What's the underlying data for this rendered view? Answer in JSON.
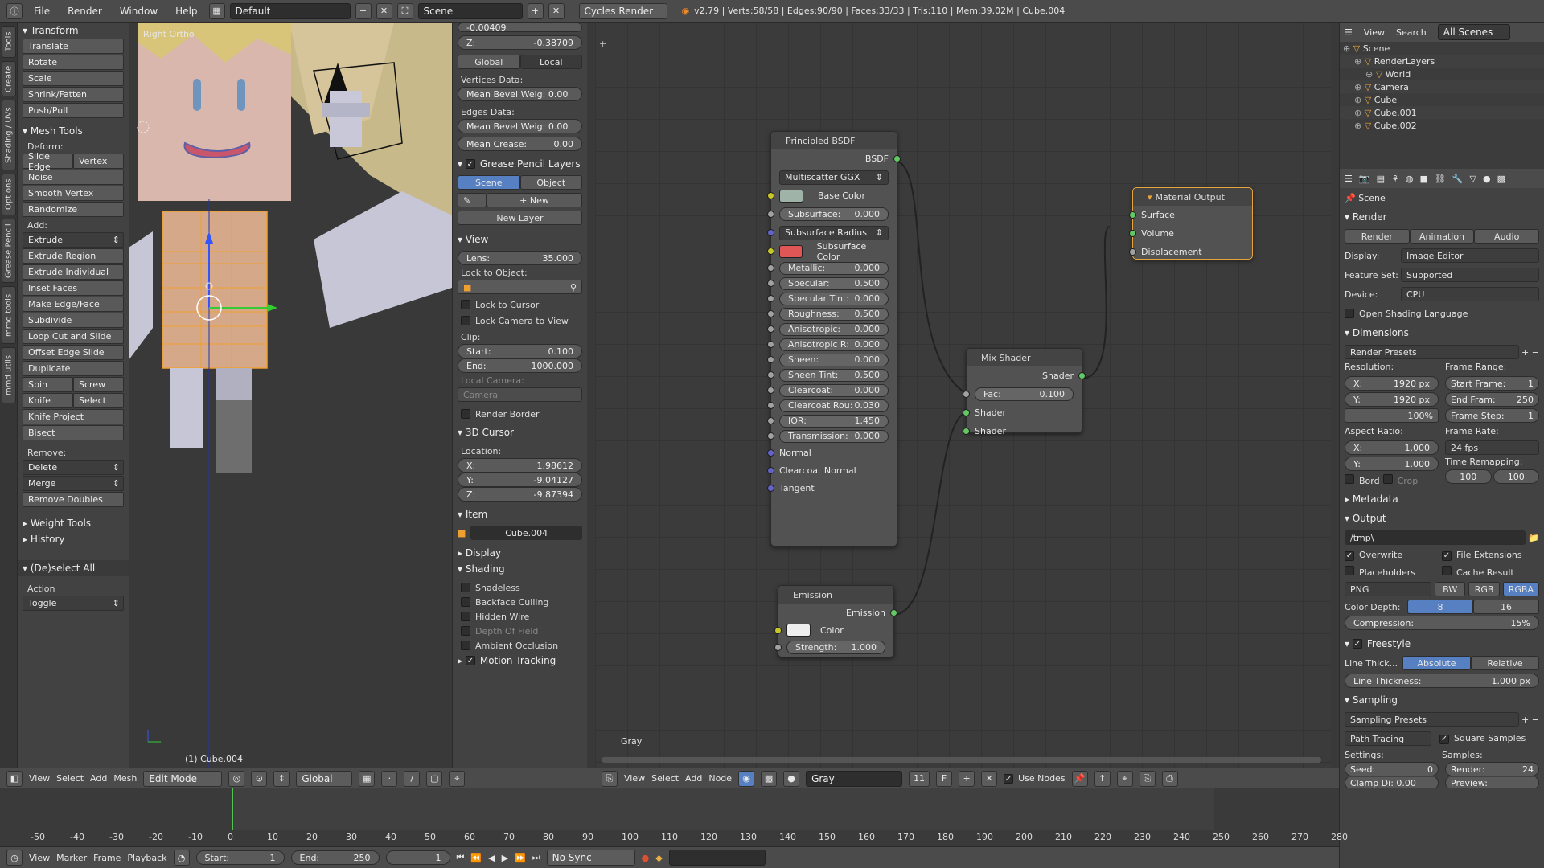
{
  "topbar": {
    "menus": [
      "File",
      "Render",
      "Window",
      "Help"
    ],
    "layout": "Default",
    "scene": "Scene",
    "engine": "Cycles Render",
    "stats": "v2.79 | Verts:58/58 | Edges:90/90 | Faces:33/33 | Tris:110 | Mem:39.02M | Cube.004"
  },
  "lefttabs": [
    "Tools",
    "Create",
    "Shading / UVs",
    "Options",
    "Grease Pencil",
    "mmd tools",
    "mmd utils"
  ],
  "tools": {
    "transform": {
      "title": "Transform",
      "items": [
        "Translate",
        "Rotate",
        "Scale",
        "Shrink/Fatten",
        "Push/Pull"
      ]
    },
    "mesh_tools": {
      "title": "Mesh Tools",
      "deform": "Deform:",
      "slide_edge": "Slide Edge",
      "vertex": "Vertex",
      "noise": "Noise",
      "smooth_vertex": "Smooth Vertex",
      "randomize": "Randomize",
      "add": "Add:",
      "extrude": "Extrude",
      "add_items": [
        "Extrude Region",
        "Extrude Individual",
        "Inset Faces",
        "Make Edge/Face",
        "Subdivide",
        "Loop Cut and Slide",
        "Offset Edge Slide",
        "Duplicate"
      ],
      "spin": "Spin",
      "screw": "Screw",
      "knife": "Knife",
      "select": "Select",
      "knife_project": "Knife Project",
      "bisect": "Bisect",
      "remove": "Remove:",
      "delete": "Delete",
      "merge": "Merge",
      "remove_doubles": "Remove Doubles"
    },
    "weight_tools": "Weight Tools",
    "history": "History",
    "deselect": {
      "title": "(De)select All",
      "action": "Action",
      "toggle": "Toggle"
    }
  },
  "viewport": {
    "view_name": "Right Ortho",
    "object_label": "(1) Cube.004"
  },
  "npanel": {
    "z_label": "Z:",
    "z_value": "-0.38709",
    "y_value": "-0.00409",
    "global": "Global",
    "local": "Local",
    "vertices_data": "Vertices Data:",
    "mean_bevel_v": "Mean Bevel Weig: 0.00",
    "edges_data": "Edges Data:",
    "mean_bevel_e": "Mean Bevel Weig: 0.00",
    "mean_crease": "Mean Crease:",
    "mean_crease_val": "0.00",
    "grease_pencil": "Grease Pencil Layers",
    "scene": "Scene",
    "object": "Object",
    "new": "New",
    "new_layer": "New Layer",
    "view": "View",
    "lens": "Lens:",
    "lens_val": "35.000",
    "lock_to_object": "Lock to Object:",
    "lock_cursor": "Lock to Cursor",
    "lock_camera": "Lock Camera to View",
    "clip": "Clip:",
    "start": "Start:",
    "start_val": "0.100",
    "end": "End:",
    "end_val": "1000.000",
    "local_camera": "Local Camera:",
    "camera": "Camera",
    "render_border": "Render Border",
    "cursor": "3D Cursor",
    "location": "Location:",
    "cx": "X:",
    "cx_val": "1.98612",
    "cy": "Y:",
    "cy_val": "-9.04127",
    "cz": "Z:",
    "cz_val": "-9.87394",
    "item": "Item",
    "item_name": "Cube.004",
    "display": "Display",
    "shading": "Shading",
    "shadeless": "Shadeless",
    "backface": "Backface Culling",
    "hidden_wire": "Hidden Wire",
    "dof": "Depth Of Field",
    "ao": "Ambient Occlusion",
    "motion": "Motion Tracking"
  },
  "nodes": {
    "principled": {
      "title": "Principled BSDF",
      "out": "BSDF",
      "dist": "Multiscatter GGX",
      "base_color": "Base Color",
      "subsurface": "Subsurface:",
      "subsurface_v": "0.000",
      "ss_radius": "Subsurface Radius",
      "ss_color": "Subsurface Color",
      "rows": [
        [
          "Metallic:",
          "0.000"
        ],
        [
          "Specular:",
          "0.500"
        ],
        [
          "Specular Tint:",
          "0.000"
        ],
        [
          "Roughness:",
          "0.500"
        ],
        [
          "Anisotropic:",
          "0.000"
        ],
        [
          "Anisotropic R:",
          "0.000"
        ],
        [
          "Sheen:",
          "0.000"
        ],
        [
          "Sheen Tint:",
          "0.500"
        ],
        [
          "Clearcoat:",
          "0.000"
        ],
        [
          "Clearcoat Rou:",
          "0.030"
        ],
        [
          "IOR:",
          "1.450"
        ],
        [
          "Transmission:",
          "0.000"
        ]
      ],
      "normal": "Normal",
      "cc_normal": "Clearcoat Normal",
      "tangent": "Tangent",
      "base_color_hex": "#9fb3a8",
      "ss_color_hex": "#e05555"
    },
    "material_output": {
      "title": "Material Output",
      "surface": "Surface",
      "volume": "Volume",
      "displacement": "Displacement"
    },
    "mix": {
      "title": "Mix Shader",
      "out": "Shader",
      "fac": "Fac:",
      "fac_v": "0.100",
      "in1": "Shader",
      "in2": "Shader"
    },
    "emission": {
      "title": "Emission",
      "out": "Emission",
      "color": "Color",
      "strength": "Strength:",
      "strength_v": "1.000"
    },
    "material_name": "Gray"
  },
  "outliner": {
    "view": "View",
    "search": "Search",
    "all_scenes": "All Scenes",
    "items": [
      "Scene",
      "RenderLayers",
      "World",
      "Camera",
      "Cube",
      "Cube.001",
      "Cube.002"
    ]
  },
  "props": {
    "scene": "Scene",
    "render": "Render",
    "render_btn": "Render",
    "animation_btn": "Animation",
    "audio_btn": "Audio",
    "display": "Display:",
    "display_v": "Image Editor",
    "feature_set": "Feature Set:",
    "feature_v": "Supported",
    "device": "Device:",
    "device_v": "CPU",
    "osl": "Open Shading Language",
    "dimensions": "Dimensions",
    "render_presets": "Render Presets",
    "resolution": "Resolution:",
    "res_x": "X:",
    "res_x_v": "1920 px",
    "res_y": "Y:",
    "res_y_v": "1920 px",
    "res_pct": "100%",
    "frame_range": "Frame Range:",
    "start_frame": "Start Frame:",
    "start_frame_v": "1",
    "end_frame": "End Fram:",
    "end_frame_v": "250",
    "frame_step": "Frame Step:",
    "frame_step_v": "1",
    "aspect": "Aspect Ratio:",
    "ax": "X:",
    "ax_v": "1.000",
    "ay": "Y:",
    "ay_v": "1.000",
    "frame_rate": "Frame Rate:",
    "fps": "24 fps",
    "bord": "Bord",
    "crop": "Crop",
    "time_remap": "Time Remapping:",
    "tr1": "100",
    "tr2": "100",
    "metadata": "Metadata",
    "output": "Output",
    "path": "/tmp\\",
    "overwrite": "Overwrite",
    "file_ext": "File Extensions",
    "placeholders": "Placeholders",
    "cache": "Cache Result",
    "format": "PNG",
    "bw": "BW",
    "rgb": "RGB",
    "rgba": "RGBA",
    "color_depth": "Color Depth:",
    "cd8": "8",
    "cd16": "16",
    "compression": "Compression:",
    "compression_v": "15%",
    "freestyle": "Freestyle",
    "line_thick": "Line Thick...",
    "absolute": "Absolute",
    "relative": "Relative",
    "line_thickness": "Line Thickness:",
    "line_thickness_v": "1.000 px",
    "sampling": "Sampling",
    "sampling_presets": "Sampling Presets",
    "path_tracing": "Path Tracing",
    "square_samples": "Square Samples",
    "settings": "Settings:",
    "samples": "Samples:",
    "seed": "Seed:",
    "seed_v": "0",
    "render_s": "Render:",
    "render_s_v": "24",
    "clamp": "Clamp Di: 0.00",
    "preview": "Preview:"
  },
  "view3d_header": {
    "view": "View",
    "select": "Select",
    "add": "Add",
    "mesh": "Mesh",
    "mode": "Edit Mode",
    "orientation": "Global"
  },
  "node_header": {
    "view": "View",
    "select": "Select",
    "add": "Add",
    "node": "Node",
    "material": "Gray",
    "users": "11",
    "fake": "F",
    "use_nodes": "Use Nodes"
  },
  "timeline": {
    "ticks": [
      "-50",
      "-40",
      "-30",
      "-20",
      "-10",
      "0",
      "10",
      "20",
      "30",
      "40",
      "50",
      "60",
      "70",
      "80",
      "90",
      "100",
      "110",
      "120",
      "130",
      "140",
      "150",
      "160",
      "170",
      "180",
      "190",
      "200",
      "210",
      "220",
      "230",
      "240",
      "250",
      "260",
      "270",
      "280"
    ],
    "view": "View",
    "marker": "Marker",
    "frame": "Frame",
    "playback": "Playback",
    "start": "Start:",
    "start_v": "1",
    "end": "End:",
    "end_v": "250",
    "current": "1",
    "sync": "No Sync"
  }
}
